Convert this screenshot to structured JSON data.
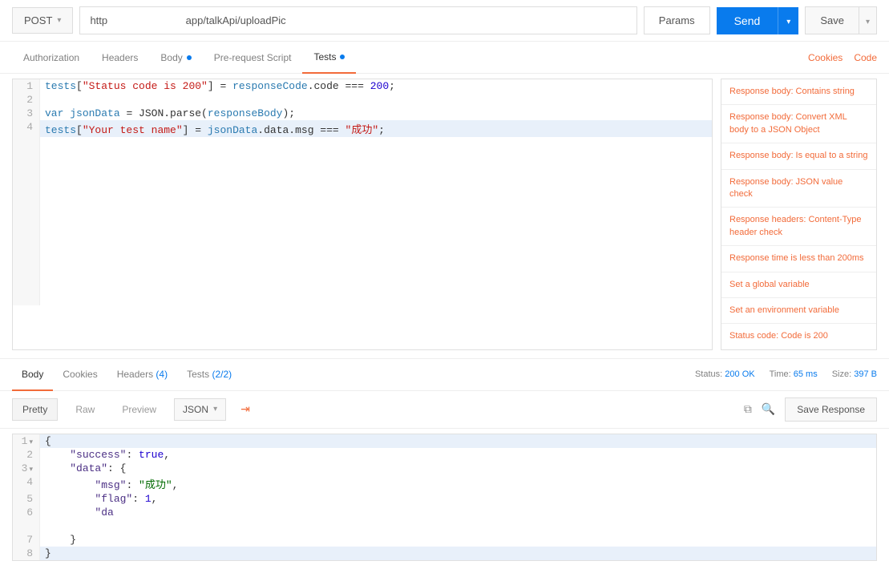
{
  "topbar": {
    "method": "POST",
    "url_prefix": "http",
    "url_suffix": "app/talkApi/uploadPic",
    "params": "Params",
    "send": "Send",
    "save": "Save"
  },
  "req_tabs": {
    "auth": "Authorization",
    "headers": "Headers",
    "body": "Body",
    "prereq": "Pre-request Script",
    "tests": "Tests",
    "cookies": "Cookies",
    "code": "Code"
  },
  "tests_code": {
    "l1": "tests[\"Status code is 200\"] = responseCode.code === 200;",
    "l2": "",
    "l3": "var jsonData = JSON.parse(responseBody);",
    "l4": "tests[\"Your test name\"] = jsonData.data.msg === \"成功\";"
  },
  "snippets": [
    "Response body: Contains string",
    "Response body: Convert XML body to a JSON Object",
    "Response body: Is equal to a string",
    "Response body: JSON value check",
    "Response headers: Content-Type header check",
    "Response time is less than 200ms",
    "Set a global variable",
    "Set an environment variable",
    "Status code: Code is 200"
  ],
  "resp_tabs": {
    "body": "Body",
    "cookies": "Cookies",
    "headers": "Headers",
    "headers_count": "(4)",
    "tests": "Tests",
    "tests_count": "(2/2)"
  },
  "resp_meta": {
    "status_lbl": "Status:",
    "status_val": "200 OK",
    "time_lbl": "Time:",
    "time_val": "65 ms",
    "size_lbl": "Size:",
    "size_val": "397 B"
  },
  "resp_toolbar": {
    "pretty": "Pretty",
    "raw": "Raw",
    "preview": "Preview",
    "format": "JSON",
    "save_resp": "Save Response"
  },
  "resp_body": {
    "l1": "{",
    "l2_key": "\"success\"",
    "l2_val": "true",
    "l3_key": "\"data\"",
    "l4_key": "\"msg\"",
    "l4_val": "\"成功\"",
    "l5_key": "\"flag\"",
    "l5_val": "1",
    "l6_key": "\"da",
    "l7": "    }",
    "l8": "}"
  }
}
